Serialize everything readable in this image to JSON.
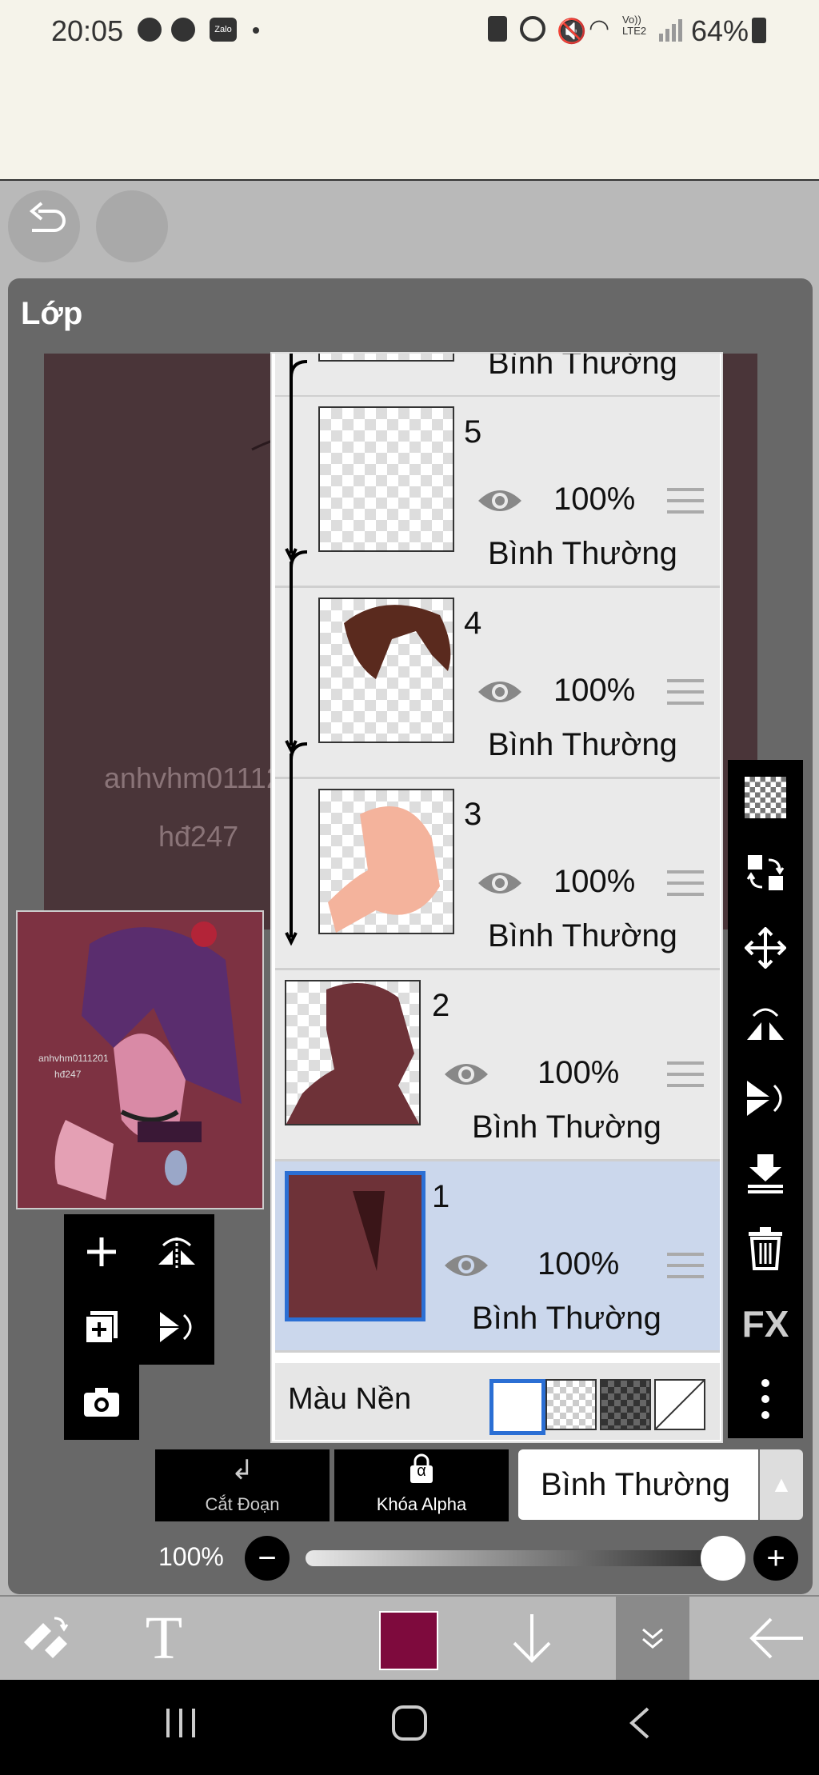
{
  "status_bar": {
    "time": "20:05",
    "left_icons": [
      "messenger-icon",
      "cat-icon",
      "zalo-icon",
      "dot-icon"
    ],
    "zalo_label": "Zalo",
    "right_icons": [
      "recycle-icon",
      "alarm-icon",
      "mute-icon",
      "wifi-icon",
      "volte-icon",
      "signal-icon"
    ],
    "volte_label": "Vo)) LTE2",
    "battery": "64%"
  },
  "panel": {
    "title": "Lớp",
    "watermark_line1": "anhvhm0111201",
    "watermark_line2": "hđ247",
    "preview_watermark_line1": "anhvhm0111201",
    "preview_watermark_line2": "hđ247"
  },
  "layers": [
    {
      "number": "",
      "opacity": "",
      "blend": "Bình Thường",
      "partial": true
    },
    {
      "number": "5",
      "opacity": "100%",
      "blend": "Bình Thường"
    },
    {
      "number": "4",
      "opacity": "100%",
      "blend": "Bình Thường"
    },
    {
      "number": "3",
      "opacity": "100%",
      "blend": "Bình Thường"
    },
    {
      "number": "2",
      "opacity": "100%",
      "blend": "Bình Thường"
    },
    {
      "number": "1",
      "opacity": "100%",
      "blend": "Bình Thường",
      "selected": true
    }
  ],
  "background_row": {
    "label": "Màu Nền"
  },
  "right_toolbar": [
    "checker-icon",
    "transfer-icon",
    "move-icon",
    "flip-horizontal-icon",
    "flip-vertical-icon",
    "merge-down-icon",
    "trash-icon",
    "fx-label",
    "more-icon"
  ],
  "right_toolbar_fx": "FX",
  "bottom_controls": {
    "cut_label": "Cắt Đoạn",
    "alpha_label": "Khóa Alpha",
    "alpha_symbol": "α",
    "blend_mode": "Bình Thường",
    "opacity": "100%"
  },
  "opacity_value": 1.0,
  "bottom_bar": {
    "text_tool": "T",
    "color": "#7e0a3d"
  },
  "colors": {
    "accent": "#2b6fd4",
    "selected_layer": "#cbd7ec",
    "brush": "#7e0a3d"
  }
}
